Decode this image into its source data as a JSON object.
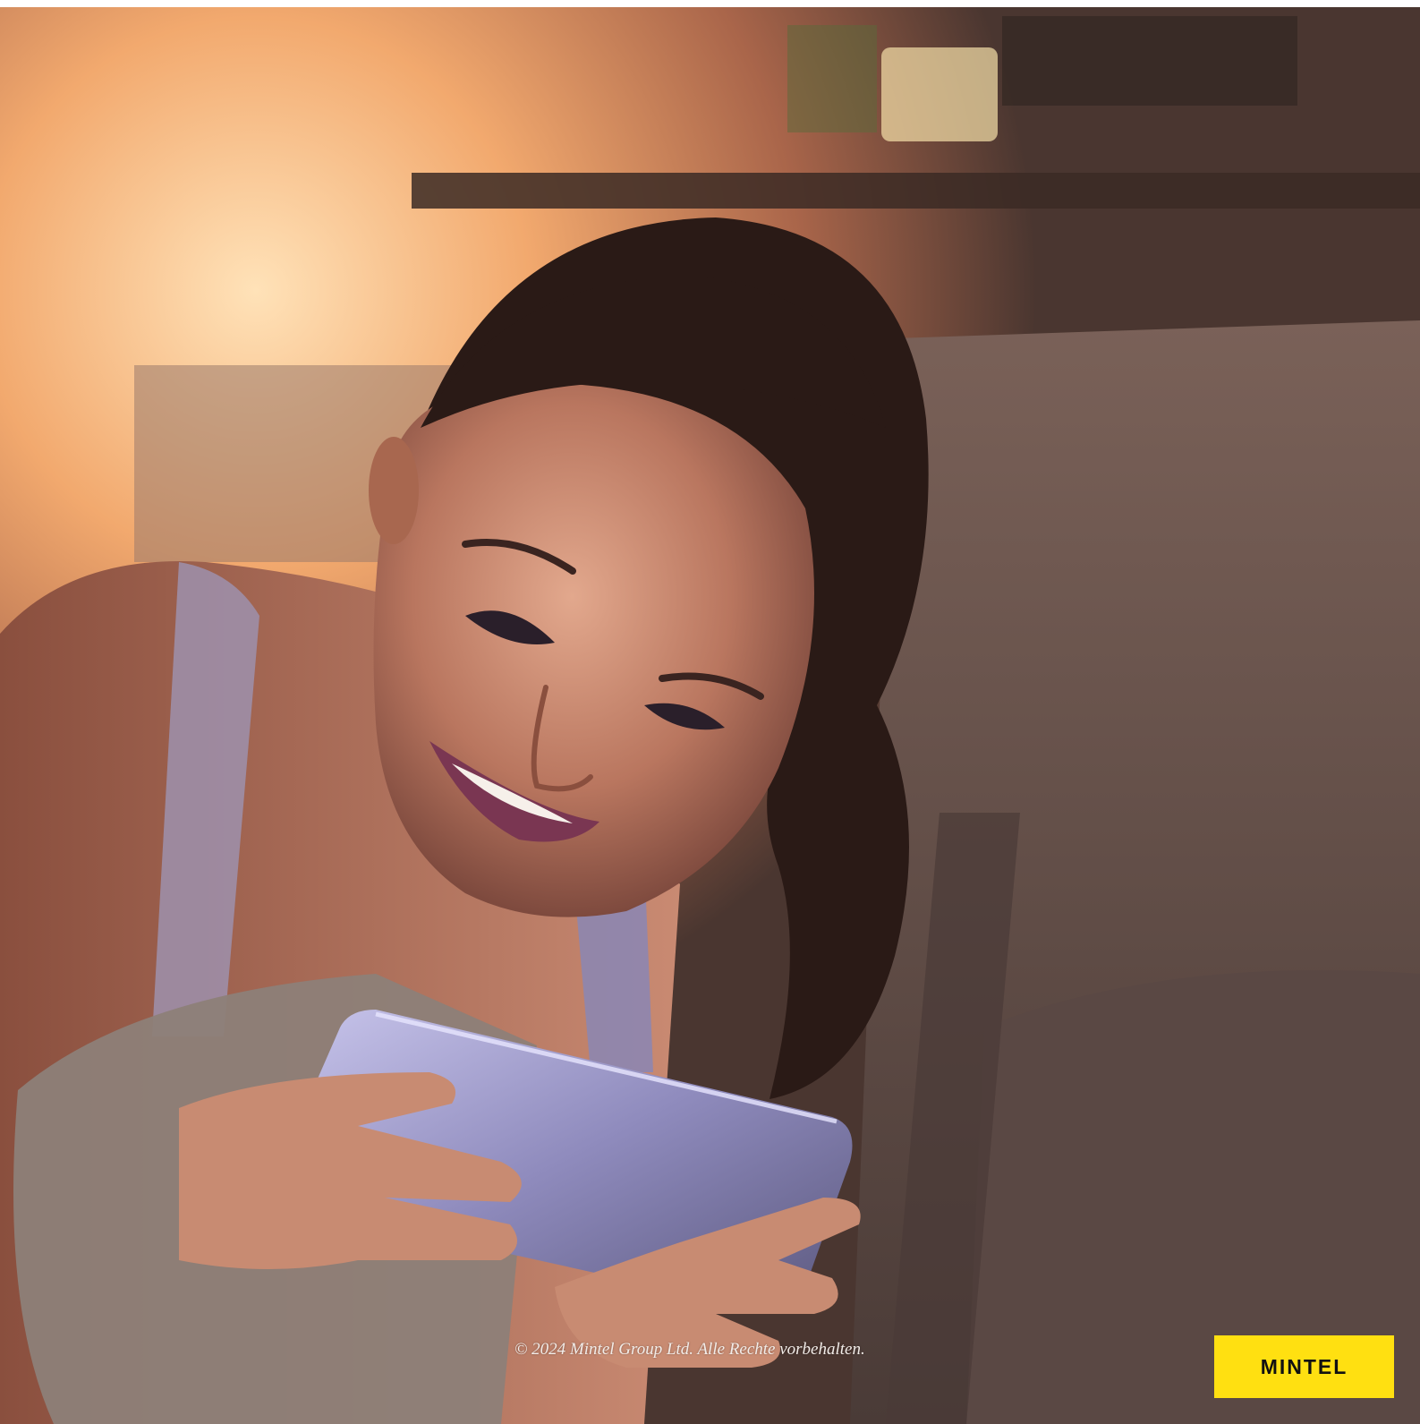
{
  "copyright": "© 2024 Mintel Group Ltd. Alle Rechte vorbehalten.",
  "logo": {
    "text": "MINTEL",
    "background": "#FFE011",
    "text_color": "#111111"
  },
  "photo": {
    "subject": "photo-woman-with-smartphone",
    "palette": {
      "warm_light": "#F7B57A",
      "sofa": "#6E5A52",
      "skin": "#C98A72",
      "hair": "#2A1A16",
      "phone": "#8E8BB8"
    }
  }
}
